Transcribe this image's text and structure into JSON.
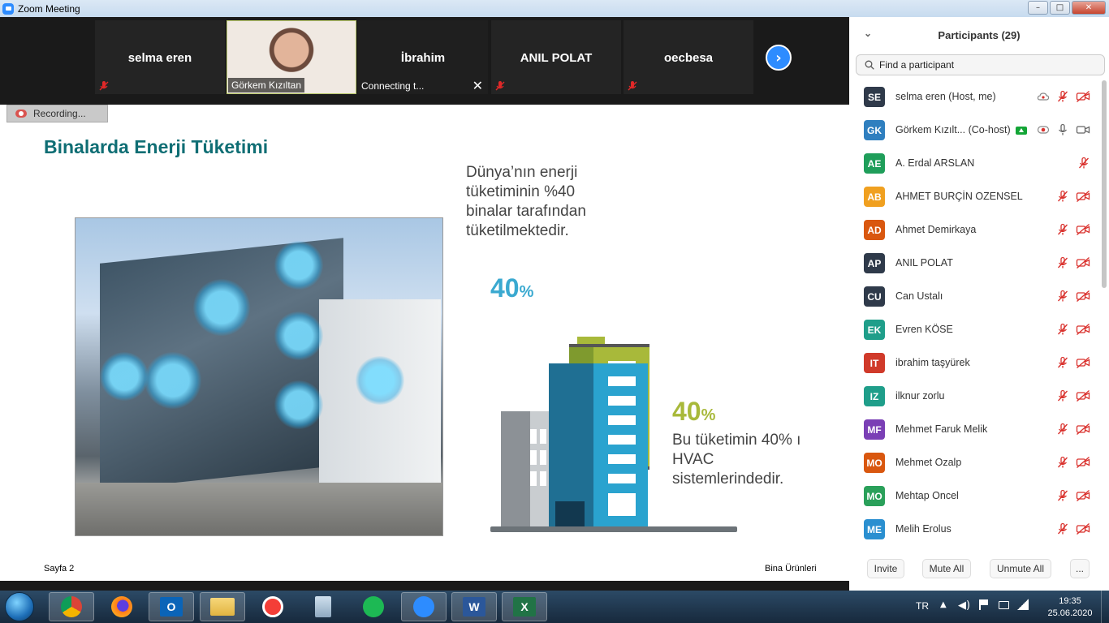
{
  "window": {
    "title": "Zoom Meeting",
    "min": "–",
    "max": "□",
    "close": "✕"
  },
  "gallery": {
    "tiles": [
      {
        "name": "selma eren"
      },
      {
        "name": "Görkem Kızıltan"
      },
      {
        "name": "Connecting t..."
      },
      {
        "name": "İbrahim"
      },
      {
        "name": "ANIL POLAT"
      },
      {
        "name": "oecbesa"
      }
    ]
  },
  "recording": {
    "label": "Recording..."
  },
  "slide": {
    "title": "Binalarda Enerji Tüketimi",
    "stat1_text": [
      "Dünya’nın enerji",
      "tüketiminin %40",
      "binalar tarafından",
      "tüketilmektedir."
    ],
    "stat1_value": "40",
    "stat2_value": "40",
    "pct_sign": "%",
    "stat2_text": [
      "Bu tüketimin 40% ı",
      "HVAC",
      "sistemlerindedir."
    ],
    "footer_left": "Sayfa 2",
    "footer_right": "Bina Ürünleri",
    "colors": {
      "title": "#0f6e74",
      "stat1": "#3aa9d0",
      "stat2": "#a8b93a",
      "green_tower": "#8ca63a",
      "blue_tower": "#2aa3cf"
    }
  },
  "participants": {
    "header": "Participants (29)",
    "search_placeholder": "Find a participant",
    "list": [
      {
        "initials": "SE",
        "name": "selma eren (Host, me)",
        "color": "#2f3a4a",
        "icons": [
          "cloud-record",
          "mic-muted",
          "video-off"
        ]
      },
      {
        "initials": "GK",
        "name": "Görkem Kızılt...  (Co-host)",
        "color": "#2f7fbf",
        "share": true,
        "icons": [
          "record",
          "mic",
          "video"
        ]
      },
      {
        "initials": "AE",
        "name": "A. Erdal ARSLAN",
        "color": "#1f9e5a",
        "icons": [
          "mic-muted"
        ]
      },
      {
        "initials": "AB",
        "name": "AHMET BURÇİN OZENSEL",
        "color": "#f0a020",
        "icons": [
          "mic-muted",
          "video-off"
        ]
      },
      {
        "initials": "AD",
        "name": "Ahmet Demirkaya",
        "color": "#d9570f",
        "icons": [
          "mic-muted",
          "video-off"
        ]
      },
      {
        "initials": "AP",
        "name": "ANIL POLAT",
        "color": "#2f3a4a",
        "icons": [
          "mic-muted",
          "video-off"
        ]
      },
      {
        "initials": "CU",
        "name": "Can Ustalı",
        "color": "#2f3a4a",
        "icons": [
          "mic-muted",
          "video-off"
        ]
      },
      {
        "initials": "EK",
        "name": "Evren KÖSE",
        "color": "#1f9e8a",
        "icons": [
          "mic-muted",
          "video-off"
        ]
      },
      {
        "initials": "IT",
        "name": "ibrahim taşyürek",
        "color": "#d03a2a",
        "icons": [
          "mic-muted",
          "video-off"
        ]
      },
      {
        "initials": "IZ",
        "name": "ilknur zorlu",
        "color": "#1f9e8a",
        "icons": [
          "mic-muted",
          "video-off"
        ]
      },
      {
        "initials": "MF",
        "name": "Mehmet Faruk Melik",
        "color": "#7a3fb5",
        "icons": [
          "mic-muted",
          "video-off"
        ]
      },
      {
        "initials": "MO",
        "name": "Mehmet Ozalp",
        "color": "#d9570f",
        "icons": [
          "mic-muted",
          "video-off"
        ]
      },
      {
        "initials": "MO",
        "name": "Mehtap Oncel",
        "color": "#2aa05a",
        "icons": [
          "mic-muted",
          "video-off"
        ]
      },
      {
        "initials": "ME",
        "name": "Melih Erolus",
        "color": "#2a8fd0",
        "icons": [
          "mic-muted",
          "video-off"
        ]
      }
    ],
    "buttons": {
      "invite": "Invite",
      "mute_all": "Mute All",
      "unmute_all": "Unmute All",
      "more": "..."
    }
  },
  "taskbar": {
    "apps": [
      "chrome",
      "firefox",
      "outlook",
      "file-explorer",
      "pocket-casts",
      "calculator",
      "spotify",
      "zoom",
      "word",
      "excel"
    ],
    "language": "TR",
    "time": "19:35",
    "date": "25.06.2020"
  }
}
